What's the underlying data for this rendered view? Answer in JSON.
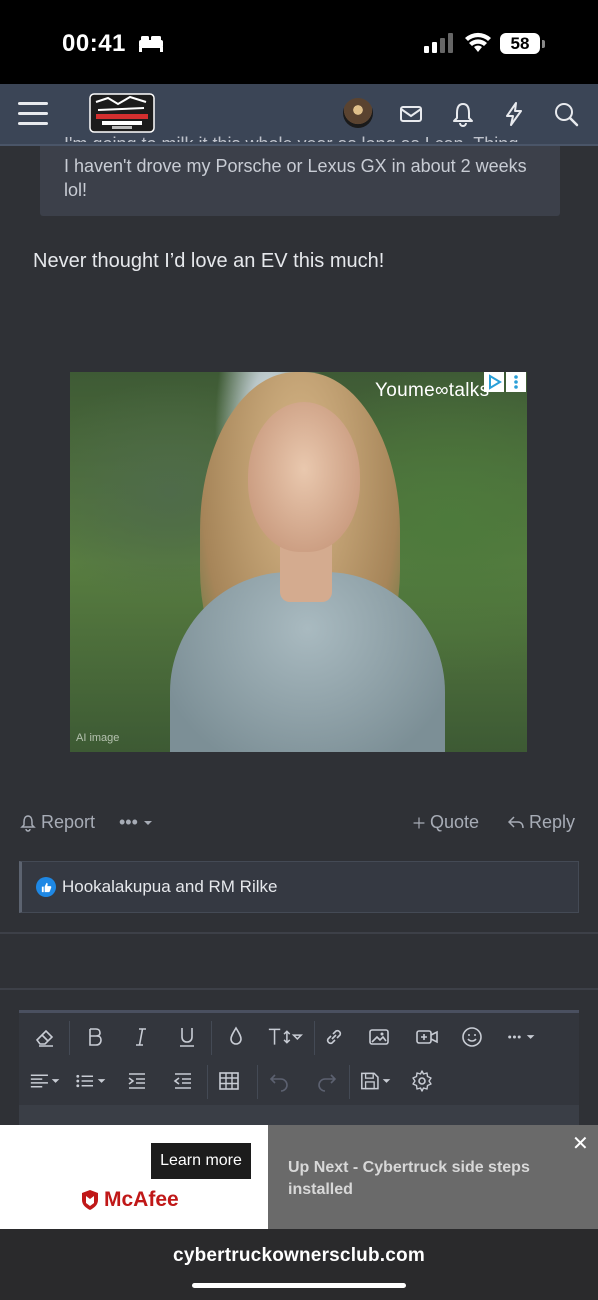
{
  "status": {
    "time": "00:41",
    "battery": "58",
    "icons": [
      "bed-icon",
      "signal-icon",
      "wifi-icon"
    ]
  },
  "nav": {
    "logo_text": "CYBERTRUCK OWNERS CLUB",
    "icons": [
      "menu-icon",
      "avatar",
      "mail-icon",
      "bell-icon",
      "bolt-icon",
      "search-icon"
    ]
  },
  "quote": {
    "cut_line": "I'm going to milk it this whole year as long as I can. Thing is,",
    "text": "I haven't drove my Porsche or Lexus GX in about 2 weeks lol!"
  },
  "post": {
    "text": "Never thought I’d love an EV this much!"
  },
  "ad": {
    "brand": "Youme∞talks",
    "label": "AI image"
  },
  "actions": {
    "report": "Report",
    "more": "•••",
    "quote": "Quote",
    "reply": "Reply"
  },
  "reactions": {
    "text": "Hookalakupua and RM Rilke"
  },
  "bottom_ad": {
    "learn_more": "Learn more",
    "brand": "McAfee",
    "up_next": "Up Next - Cybertruck side steps installed",
    "close": "✕"
  },
  "urlbar": {
    "url": "cybertruckownersclub.com"
  },
  "colors": {
    "background": "#2f3136",
    "nav": "#3b4556",
    "accent_like": "#1e88e5",
    "mcafee": "#c01818"
  }
}
